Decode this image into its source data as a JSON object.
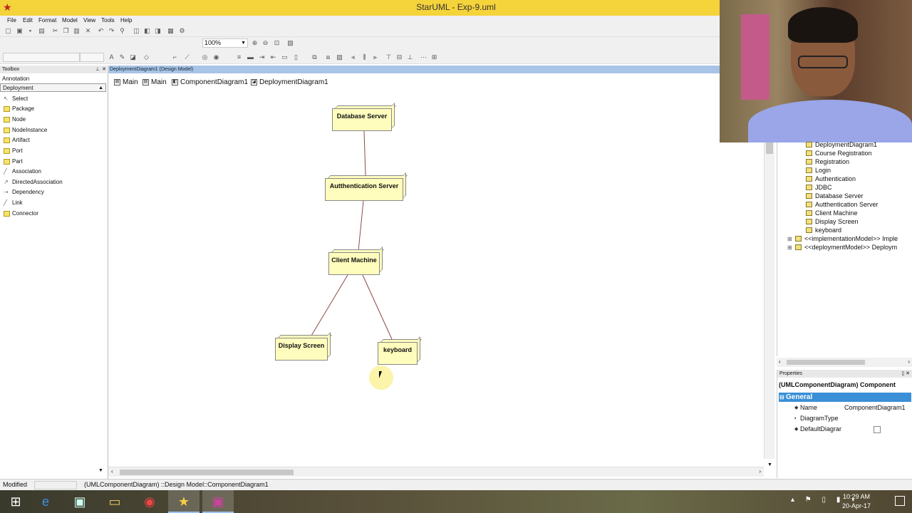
{
  "window": {
    "title": "StarUML - Exp-9.uml"
  },
  "menu": [
    "File",
    "Edit",
    "Format",
    "Model",
    "View",
    "Tools",
    "Help"
  ],
  "zoom": "100%",
  "toolbox": {
    "title": "Toolbox",
    "category_annotation": "Annotation",
    "category_active": "Deployment",
    "tools": [
      "Select",
      "Package",
      "Node",
      "NodeInstance",
      "Artifact",
      "Port",
      "Part",
      "Association",
      "DirectedAssociation",
      "Dependency",
      "Link",
      "Connector"
    ]
  },
  "editor": {
    "header": "DeploymentDiagram1 (Design Model)",
    "tabs": [
      "Main",
      "Main",
      "ComponentDiagram1",
      "DeploymentDiagram1"
    ]
  },
  "diagram": {
    "nodes": [
      {
        "id": "db",
        "label": "Database Server"
      },
      {
        "id": "auth",
        "label": "Autthentication Server"
      },
      {
        "id": "client",
        "label": "Client Machine"
      },
      {
        "id": "display",
        "label": "Display Screen"
      },
      {
        "id": "kbd",
        "label": "keyboard"
      }
    ]
  },
  "model_tree": {
    "items": [
      {
        "label": "DeploymentDiagram1",
        "expand": ""
      },
      {
        "label": "Course Registration",
        "expand": ""
      },
      {
        "label": "Registration",
        "expand": ""
      },
      {
        "label": "Login",
        "expand": ""
      },
      {
        "label": "Authentication",
        "expand": ""
      },
      {
        "label": "JDBC",
        "expand": ""
      },
      {
        "label": "Database Server",
        "expand": ""
      },
      {
        "label": "Autthentication Server",
        "expand": ""
      },
      {
        "label": "Client Machine",
        "expand": ""
      },
      {
        "label": "Display Screen",
        "expand": ""
      },
      {
        "label": "keyboard",
        "expand": ""
      },
      {
        "label": "<<implementationModel>> Imple",
        "expand": "⊞"
      },
      {
        "label": "<<deploymentModel>> Deploym",
        "expand": "⊞"
      }
    ]
  },
  "properties": {
    "title": "Properties",
    "selected": "(UMLComponentDiagram) Component",
    "group": "General",
    "rows": [
      {
        "key": "Name",
        "value": "ComponentDiagram1"
      },
      {
        "key": "DiagramType",
        "value": ""
      },
      {
        "key": "DefaultDiagrar",
        "value": ""
      }
    ]
  },
  "status": {
    "mode": "Modified",
    "path": "(UMLComponentDiagram) ::Design Model::ComponentDiagram1"
  },
  "taskbar": {
    "time": "10:29 AM",
    "date": "20-Apr-17"
  }
}
